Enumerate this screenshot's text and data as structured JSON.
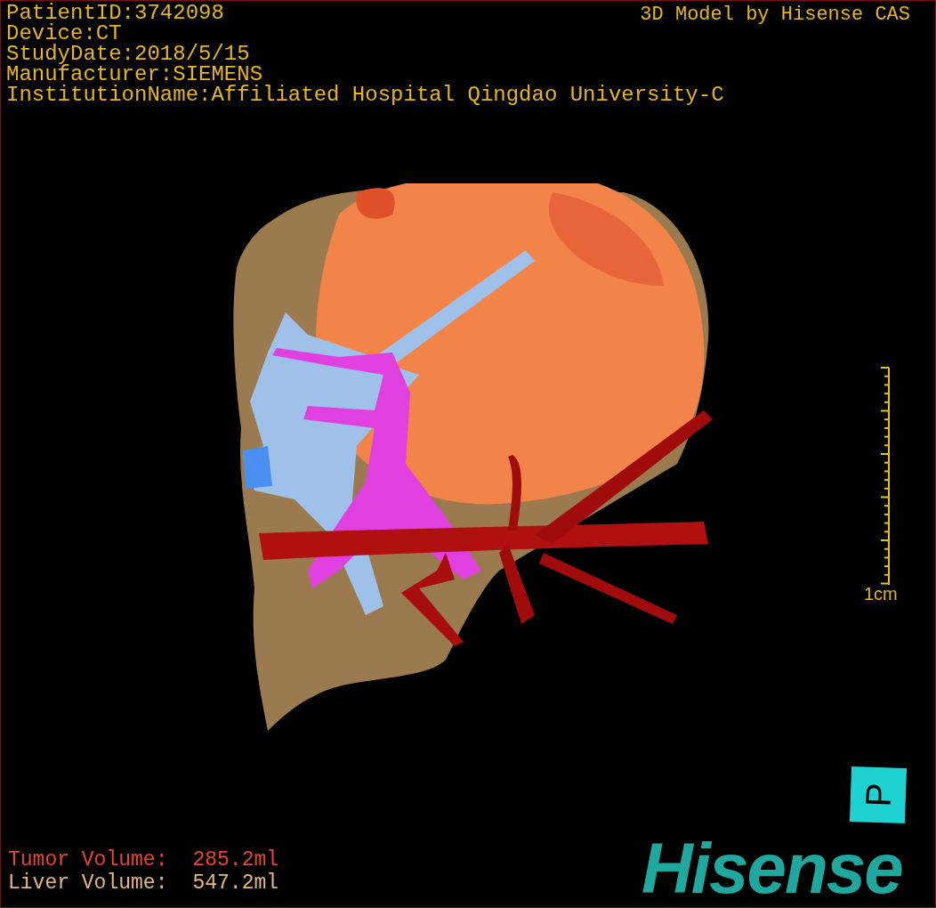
{
  "header": {
    "info_lines": [
      "PatientID:3742098",
      "Device:CT",
      "StudyDate:2018/5/15",
      "Manufacturer:SIEMENS",
      "InstitutionName:Affiliated Hospital Qingdao University-C"
    ],
    "credit": "3D Model by Hisense CAS"
  },
  "scale": {
    "label": "1cm"
  },
  "orientation": {
    "label": "P"
  },
  "volumes": [
    {
      "label": "Tumor Volume:",
      "value": "285.2ml",
      "color": "#e8452f"
    },
    {
      "label": "Liver Volume:",
      "value": "547.2ml",
      "color": "#e6b87c"
    }
  ],
  "logo": {
    "text": "Hisense"
  }
}
